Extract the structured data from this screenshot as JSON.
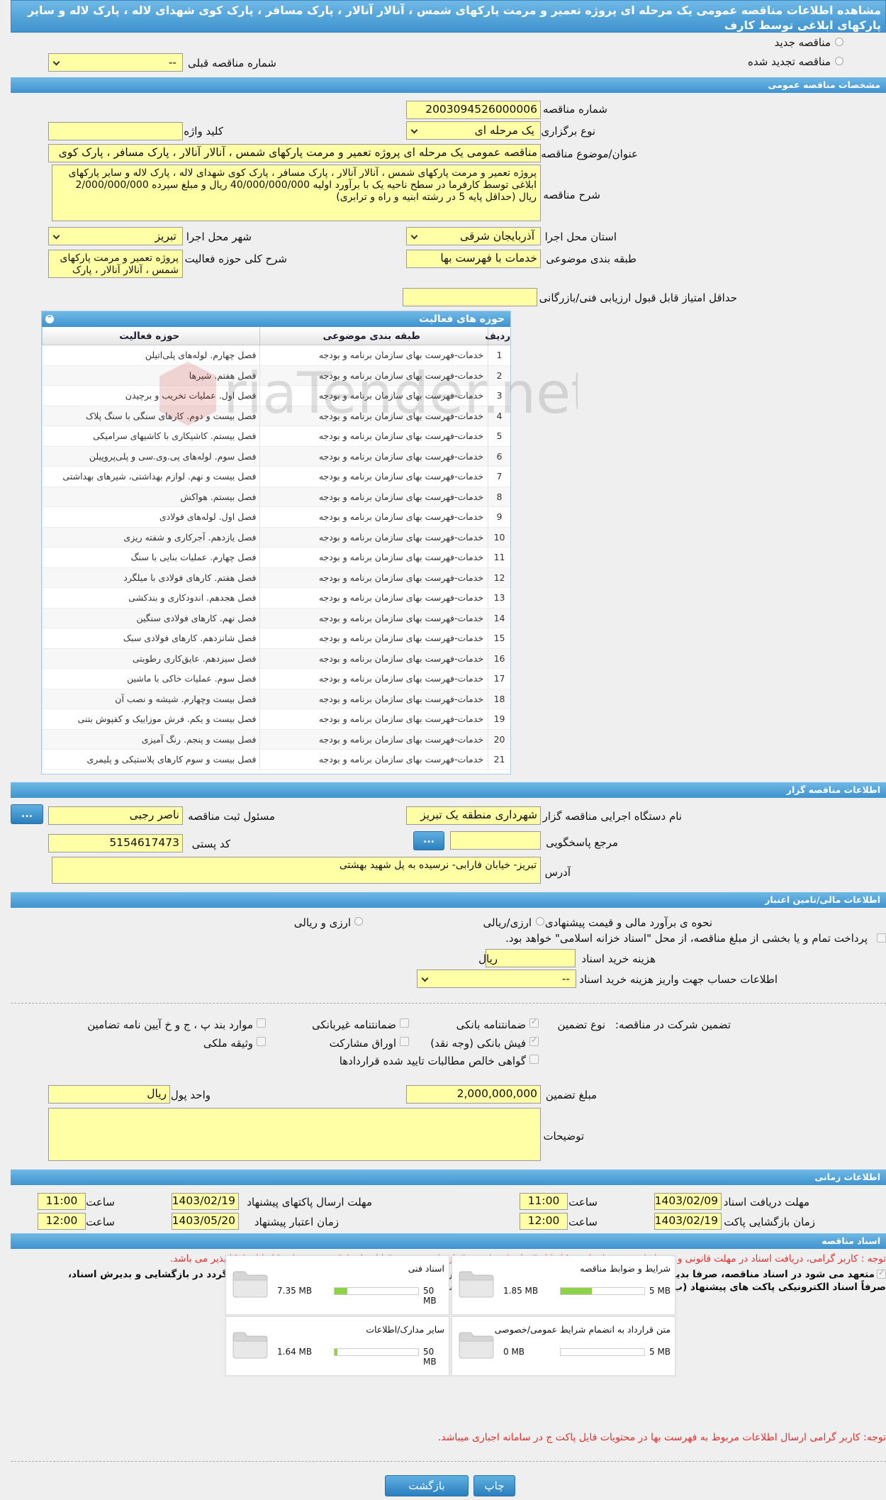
{
  "header": {
    "title": "مشاهده اطلاعات مناقصه عمومی یک مرحله ای پروژه تعمیر و مرمت پارکهای شمس ، آنالار آنالار ، پارک مسافر ، پارک کوی شهدای لاله ، پارک لاله و سایر پارکهای ابلاغی توسط کارف"
  },
  "tender_mode": {
    "new_label": "مناقصه جدید",
    "renewed_label": "مناقصه تجدید شده",
    "prev_label": "شماره مناقصه قبلی",
    "prev_value": "--"
  },
  "sections": {
    "general": "مشخصات مناقصه عمومی",
    "organizer": "اطلاعات مناقصه گزار",
    "financial": "اطلاعات مالی/تامین اعتبار",
    "timing": "اطلاعات زمانی",
    "documents": "اسناد مناقصه"
  },
  "general": {
    "number_label": "شماره مناقصه",
    "number_value": "2003094526000006",
    "type_label": "نوع برگزاری",
    "type_value": "یک مرحله ای",
    "keyword_label": "کلید واژه",
    "keyword_value": "",
    "subject_label": "عنوان/موضوع مناقصه",
    "subject_value": "مناقصه عمومی یک مرحله ای پروژه تعمیر و مرمت پارکهای شمس ، آنالار آنالار ، پارک مسافر ، پارک کوی",
    "desc_label": "شرح مناقصه",
    "desc_value": "پروژه تعمیر و مرمت پارکهای شمس ، آنالار آنالار ، پارک مسافر ، پارک کوی شهدای لاله ، پارک لاله و سایر پارکهای ابلاغی توسط کارفرما در سطح ناحیه یک با برآورد اولیه 40/000/000/000 ریال و مبلغ سپرده 2/000/000/000 ریال (حداقل پایه 5 در رشته ابنیه و  راه و ترابری)",
    "province_label": "استان محل اجرا",
    "province_value": "آذربایجان شرقی",
    "city_label": "شهر محل اجرا",
    "city_value": "تبریز",
    "category_label": "طبقه بندی موضوعی",
    "category_value": "خدمات با فهرست بها",
    "scope_label": "شرح کلی حوزه فعالیت",
    "scope_value": "پروژه تعمیر و مرمت پارکهای شمس ، آنالار آنالار ، پارک",
    "minscore_label": "حداقل امتیاز قابل قبول ارزیابی فنی/بازرگانی",
    "minscore_value": ""
  },
  "activity": {
    "title": "حوزه های فعالیت",
    "col_row": "ردیف",
    "col_category": "طبقه بندی موضوعی",
    "col_field": "حوزه فعالیت",
    "rows": [
      {
        "n": "1",
        "cat": "خدمات-فهرست بهای سازمان برنامه و بودجه",
        "field": "فصل چهارم. لوله‌های پلی‌اتیلن"
      },
      {
        "n": "2",
        "cat": "خدمات-فهرست بهای سازمان برنامه و بودجه",
        "field": "فصل هفتم. شیرها"
      },
      {
        "n": "3",
        "cat": "خدمات-فهرست بهای سازمان برنامه و بودجه",
        "field": "فصل اول. عملیات تخریب و برچیدن"
      },
      {
        "n": "4",
        "cat": "خدمات-فهرست بهای سازمان برنامه و بودجه",
        "field": "فصل بیست و دوم. کارهای سنگی با سنگ پلاک"
      },
      {
        "n": "5",
        "cat": "خدمات-فهرست بهای سازمان برنامه و بودجه",
        "field": "فصل بیستم. کاشیکاری با کاشیهای سرامیکی"
      },
      {
        "n": "6",
        "cat": "خدمات-فهرست بهای سازمان برنامه و بودجه",
        "field": "فصل سوم. لوله‌های پی.وی.سی و پلی‌پروپیلن"
      },
      {
        "n": "7",
        "cat": "خدمات-فهرست بهای سازمان برنامه و بودجه",
        "field": "فصل بیست و نهم. لوازم بهداشتی، شیرهای بهداشتی"
      },
      {
        "n": "8",
        "cat": "خدمات-فهرست بهای سازمان برنامه و بودجه",
        "field": "فصل بیستم. هواکش"
      },
      {
        "n": "9",
        "cat": "خدمات-فهرست بهای سازمان برنامه و بودجه",
        "field": "فصل اول. لوله‌های فولادی"
      },
      {
        "n": "10",
        "cat": "خدمات-فهرست بهای سازمان برنامه و بودجه",
        "field": "فصل یازدهم. آجرکاری و شفته ریزی"
      },
      {
        "n": "11",
        "cat": "خدمات-فهرست بهای سازمان برنامه و بودجه",
        "field": "فصل چهارم. عملیات بنایی با سنگ"
      },
      {
        "n": "12",
        "cat": "خدمات-فهرست بهای سازمان برنامه و بودجه",
        "field": "فصل هفتم. کارهای فولادی با میلگرد"
      },
      {
        "n": "13",
        "cat": "خدمات-فهرست بهای سازمان برنامه و بودجه",
        "field": "فصل هجدهم. اندودکاری و بندکشی"
      },
      {
        "n": "14",
        "cat": "خدمات-فهرست بهای سازمان برنامه و بودجه",
        "field": "فصل نهم. کارهای فولادی سنگین"
      },
      {
        "n": "15",
        "cat": "خدمات-فهرست بهای سازمان برنامه و بودجه",
        "field": "فصل شانزدهم. کارهای فولادی سبک"
      },
      {
        "n": "16",
        "cat": "خدمات-فهرست بهای سازمان برنامه و بودجه",
        "field": "فصل سیزدهم. عایق‌کاری رطوبتی"
      },
      {
        "n": "17",
        "cat": "خدمات-فهرست بهای سازمان برنامه و بودجه",
        "field": "فصل سوم. عملیات خاکی با ماشین"
      },
      {
        "n": "18",
        "cat": "خدمات-فهرست بهای سازمان برنامه و بودجه",
        "field": "فصل بیست وچهارم. شیشه و نصب آن"
      },
      {
        "n": "19",
        "cat": "خدمات-فهرست بهای سازمان برنامه و بودجه",
        "field": "فصل بیست و یکم. فرش موزاییک و کفپوش بتنی"
      },
      {
        "n": "20",
        "cat": "خدمات-فهرست بهای سازمان برنامه و بودجه",
        "field": "فصل بیست و پنجم. رنگ آمیزی"
      },
      {
        "n": "21",
        "cat": "خدمات-فهرست بهای سازمان برنامه و بودجه",
        "field": "فصل بیست و سوم کارهای پلاستیکی و پلیمری"
      }
    ]
  },
  "organizer": {
    "org_label": "نام دستگاه اجرایی مناقصه گزار",
    "org_value": "شهرداری منطقه یک تبریز",
    "resp_label": "مسئول ثبت مناقصه",
    "resp_value": "ناصر رجبی",
    "ref_label": "مرجع پاسخگویی",
    "ref_value": "",
    "postal_label": "کد پستی",
    "postal_value": "5154617473",
    "address_label": "آدرس",
    "address_value": "تبریز- خیابان فارابی- نرسیده به پل شهید بهشتی",
    "more_btn": "..."
  },
  "financial": {
    "method_label": "نحوه ی برآورد مالی و قیمت پیشنهادی",
    "opt1": "ارزی/ریالی",
    "opt2": "ارزی و ریالی",
    "islamic_text": "پرداخت تمام و یا بخشی از مبلغ مناقصه، از محل \"اسناد خزانه اسلامی\" خواهد بود.",
    "doccost_label": "هزینه خرید اسناد",
    "doccost_value": "",
    "unit": "ریال",
    "account_label": "اطلاعات حساب جهت واریز هزینه خرید اسناد",
    "account_value": "--",
    "guar_label": "تضمین شرکت در مناقصه:",
    "guar_type_label": "نوع تضمین",
    "g1": "ضمانتنامه بانکی",
    "g2": "ضمانتنامه غیربانکی",
    "g3": "موارد بند پ ، ج و خ آیین نامه تضامین",
    "g4": "فیش بانکی (وجه نقد)",
    "g5": "اوراق مشارکت",
    "g6": "وثیقه ملکی",
    "g7": "گواهی خالص مطالبات تایید شده قراردادها",
    "amount_label": "مبلغ تضمین",
    "amount_value": "2,000,000,000",
    "unit_label": "واحد پول",
    "unit_value": "ریال",
    "notes_label": "توضیحات",
    "notes_value": ""
  },
  "timing": {
    "doc_receive_label": "مهلت دریافت اسناد",
    "doc_receive_date": "1403/02/09",
    "doc_receive_time": "11:00",
    "send_label": "مهلت ارسال پاکتهای پیشنهاد",
    "send_date": "1403/02/19",
    "send_time": "11:00",
    "open_label": "زمان بازگشایی پاکت ها",
    "open_date": "1403/02/19",
    "open_time": "12:00",
    "valid_label": "زمان اعتبار پیشنهاد",
    "valid_date": "1403/05/20",
    "valid_time": "12:00",
    "time_label": "ساعت"
  },
  "documents": {
    "note1": "توجه : کاربر گرامی، دریافت اسناد در مهلت قانونی و پس از افزودن فراخوان به کارتابل \"فراخوان های من\"، از طریق ستون \"دانلود اسناد\" موجود در این کارتابل، امکانپذیر می باشد.",
    "pledge_line1": "متعهد می شود در اسناد مناقصه، صرفا بدیرش اسناد الکترونیکی پاکت های (ب) و (ج) مجهز به امضای الکترونیکی قید شده باشد. تعهد می گردد در بازگشایی و بدیرش اسناد،",
    "pledge_line2": "صرفاً اسناد الکترونیکی پاکت های پیشنهاد (ب) و (ج) مجهز به امضای الکترونیکی صاحبان امضای مجاز مورد پذیرش واقع گردد.",
    "files": [
      {
        "name": "شرایط و ضوابط مناقصه",
        "size": "1.85 MB",
        "max": "5 MB",
        "fill": 0.37
      },
      {
        "name": "اسناد فنی",
        "size": "7.35 MB",
        "max": "50 MB",
        "fill": 0.15
      },
      {
        "name": "متن قرارداد به انضمام شرایط عمومی/خصوصی",
        "size": "0 MB",
        "max": "5 MB",
        "fill": 0.0
      },
      {
        "name": "سایر مدارک/اطلاعات",
        "size": "1.64 MB",
        "max": "50 MB",
        "fill": 0.03
      }
    ],
    "note2": "توجه: کاربر گرامی ارسال اطلاعات مربوط به فهرست بها در محتویات فایل پاکت ج در سامانه اجباری میباشد."
  },
  "buttons": {
    "print": "چاپ",
    "back": "بازگشت"
  }
}
